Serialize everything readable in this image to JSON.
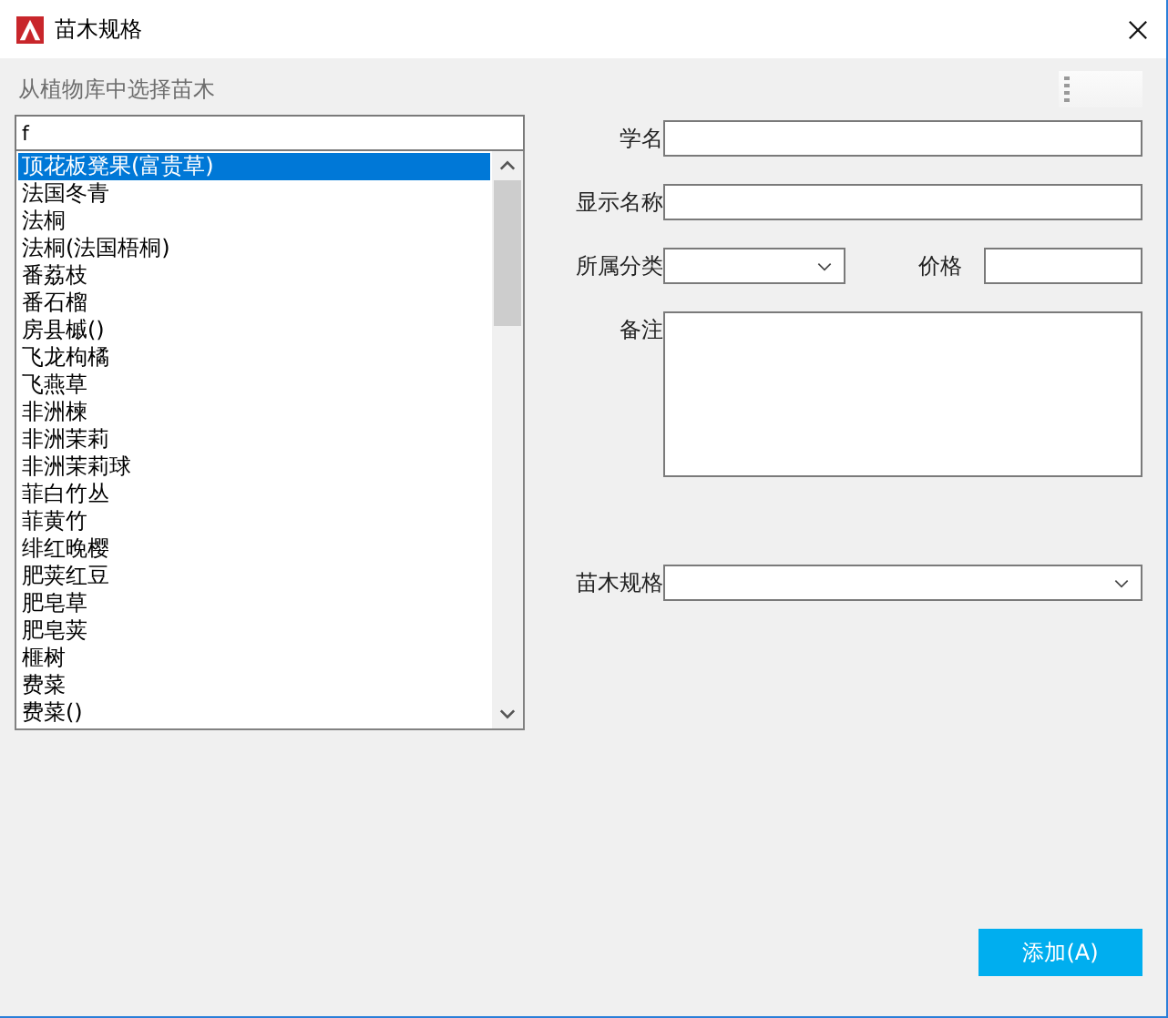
{
  "window": {
    "title": "苗木规格"
  },
  "library": {
    "heading": "从植物库中选择苗木",
    "search": {
      "value": "f"
    },
    "items": [
      {
        "label": "顶花板凳果(富贵草)",
        "selected": true
      },
      {
        "label": "法国冬青",
        "selected": false
      },
      {
        "label": "法桐",
        "selected": false
      },
      {
        "label": "法桐(法国梧桐)",
        "selected": false
      },
      {
        "label": "番荔枝",
        "selected": false
      },
      {
        "label": "番石榴",
        "selected": false
      },
      {
        "label": "房县槭()",
        "selected": false
      },
      {
        "label": "飞龙枸橘",
        "selected": false
      },
      {
        "label": "飞燕草",
        "selected": false
      },
      {
        "label": "非洲楝",
        "selected": false
      },
      {
        "label": "非洲茉莉",
        "selected": false
      },
      {
        "label": "非洲茉莉球",
        "selected": false
      },
      {
        "label": "菲白竹丛",
        "selected": false
      },
      {
        "label": "菲黄竹",
        "selected": false
      },
      {
        "label": "绯红晚樱",
        "selected": false
      },
      {
        "label": "肥荚红豆",
        "selected": false
      },
      {
        "label": "肥皂草",
        "selected": false
      },
      {
        "label": "肥皂荚",
        "selected": false
      },
      {
        "label": "榧树",
        "selected": false
      },
      {
        "label": "费菜",
        "selected": false
      },
      {
        "label": "费菜()",
        "selected": false
      }
    ]
  },
  "form": {
    "fields": [
      {
        "label": "学名",
        "kind": "text"
      },
      {
        "label": "显示名称",
        "kind": "text"
      },
      {
        "label": "所属分类",
        "kind": "select",
        "side_label": "价格"
      },
      {
        "label": "备注",
        "kind": "textarea"
      },
      {
        "label": "苗木规格",
        "kind": "select"
      }
    ]
  },
  "buttons": [
    {
      "label": "添加(A)"
    }
  ]
}
